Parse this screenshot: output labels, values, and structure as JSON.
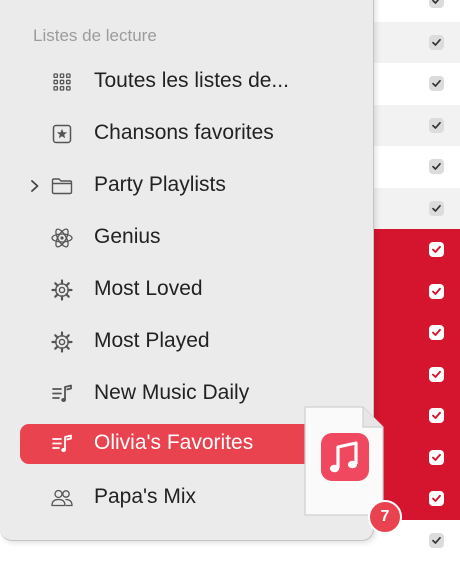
{
  "sidebar": {
    "section_title": "Listes de lecture",
    "items": [
      {
        "label": "Toutes les listes de...",
        "icon": "grid-icon"
      },
      {
        "label": "Chansons favorites",
        "icon": "star-box-icon"
      },
      {
        "label": "Party Playlists",
        "icon": "folder-icon"
      },
      {
        "label": "Genius",
        "icon": "atom-icon"
      },
      {
        "label": "Most Loved",
        "icon": "gear-icon"
      },
      {
        "label": "Most Played",
        "icon": "gear-icon"
      },
      {
        "label": "New Music Daily",
        "icon": "playlist-icon"
      },
      {
        "label": "Olivia's Favorites",
        "icon": "playlist-icon",
        "selected": true
      },
      {
        "label": "Papa's Mix",
        "icon": "people-icon"
      }
    ]
  },
  "drag": {
    "count": "7",
    "icon": "music-note-icon"
  },
  "colors": {
    "accent": "#e8434f",
    "selected_row": "#d5142d",
    "sidebar_bg": "#ebebeb"
  }
}
